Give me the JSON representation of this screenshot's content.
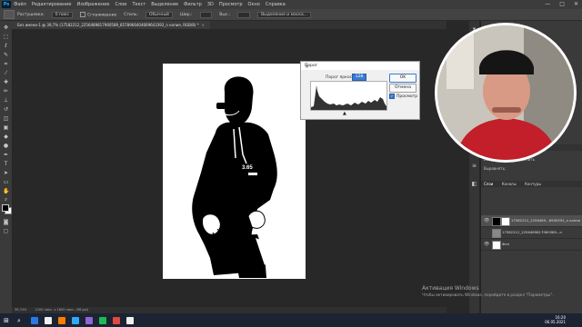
{
  "menu": {
    "logo": "Ps",
    "items": [
      "Файл",
      "Редактирование",
      "Изображение",
      "Слои",
      "Текст",
      "Выделение",
      "Фильтр",
      "3D",
      "Просмотр",
      "Окно",
      "Справка"
    ],
    "window_controls": [
      "—",
      "□",
      "✕"
    ]
  },
  "options_bar": {
    "feather_label": "Растушевка:",
    "feather_value": "0 пикс",
    "antialias_label": "Сглаживание",
    "style_label": "Стиль:",
    "style_value": "Обычный",
    "width_label": "Шир.:",
    "height_label": "Выс.:",
    "select_mask_label": "Выделение и маска..."
  },
  "document": {
    "tab_title": "Без имени-1 @ 39,7% (17582212_2256489817960589_8578966404669643392_n копия, RGB/8) *",
    "tab_close": "×"
  },
  "status_bar": {
    "zoom": "39,74%",
    "info": "1200 пикс. x 1800 пикс. (96 ppi)"
  },
  "threshold_dialog": {
    "title": "Порог",
    "close": "×",
    "level_label": "Порог яркости:",
    "level_value": "128",
    "ok_label": "OK",
    "cancel_label": "Отмена",
    "preview_label": "Просмотр",
    "preview_checked": true
  },
  "right_panel": {
    "tabs_top": [
      "Свойства",
      "Коррекция"
    ],
    "subtitle": "Выделить и распределить",
    "align_label": "Выровнять:",
    "layers_tabs": [
      "Слои",
      "Каналы",
      "Контуры"
    ],
    "layers": [
      {
        "name": "17582212_2256489...8900592_n копия",
        "visible": true,
        "selected": true
      },
      {
        "name": "17582212_2256489817960589...n",
        "visible": false,
        "selected": false
      },
      {
        "name": "Фон",
        "visible": true,
        "selected": false
      }
    ]
  },
  "watermark": {
    "line1": "Активация Windows",
    "line2": "Чтобы активировать Windows, перейдите в раздел \"Параметры\"."
  },
  "taskbar": {
    "time": "16:20",
    "date": "06.05.2021",
    "apps": [
      "#2b78e4",
      "#ffffff",
      "#ff7c00",
      "#31a8ff",
      "#8f66d8",
      "#1db954",
      "#e04a3f",
      "#ffffff"
    ]
  }
}
